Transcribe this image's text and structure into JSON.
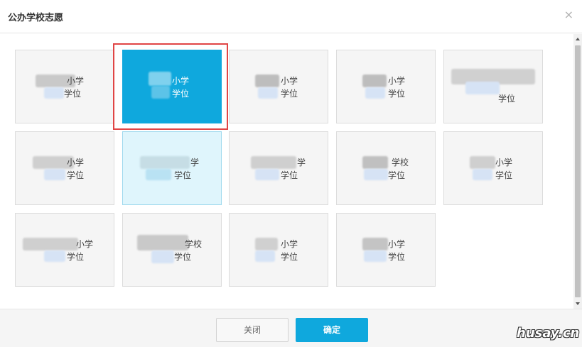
{
  "dialog": {
    "title": "公办学校志愿",
    "close_icon": "×"
  },
  "cards": [
    {
      "line1": "小学",
      "line2": "学位",
      "state": "normal"
    },
    {
      "line1": "小学",
      "line2": "学位",
      "state": "selected"
    },
    {
      "line1": "小学",
      "line2": "学位",
      "state": "normal"
    },
    {
      "line1": "小学",
      "line2": "学位",
      "state": "normal"
    },
    {
      "line1": "",
      "line2": "学位",
      "state": "normal"
    },
    {
      "line1": "小学",
      "line2": "学位",
      "state": "normal"
    },
    {
      "line1": "学",
      "line2": "学位",
      "state": "hover"
    },
    {
      "line1": "学",
      "line2": "学位",
      "state": "normal"
    },
    {
      "line1": "学校",
      "line2": "学位",
      "state": "normal"
    },
    {
      "line1": "小学",
      "line2": "学位",
      "state": "normal"
    },
    {
      "line1": "小学",
      "line2": "学位",
      "state": "normal"
    },
    {
      "line1": "学校",
      "line2": "学位",
      "state": "normal"
    },
    {
      "line1": "小学",
      "line2": "学位",
      "state": "normal"
    },
    {
      "line1": "小学",
      "line2": "学位",
      "state": "normal"
    }
  ],
  "footer": {
    "close_label": "关闭",
    "confirm_label": "确定"
  },
  "watermark": "husay.cn",
  "colors": {
    "accent": "#0fa8dd",
    "selected_outline": "#e04545",
    "hover_bg": "#dff5fc"
  }
}
